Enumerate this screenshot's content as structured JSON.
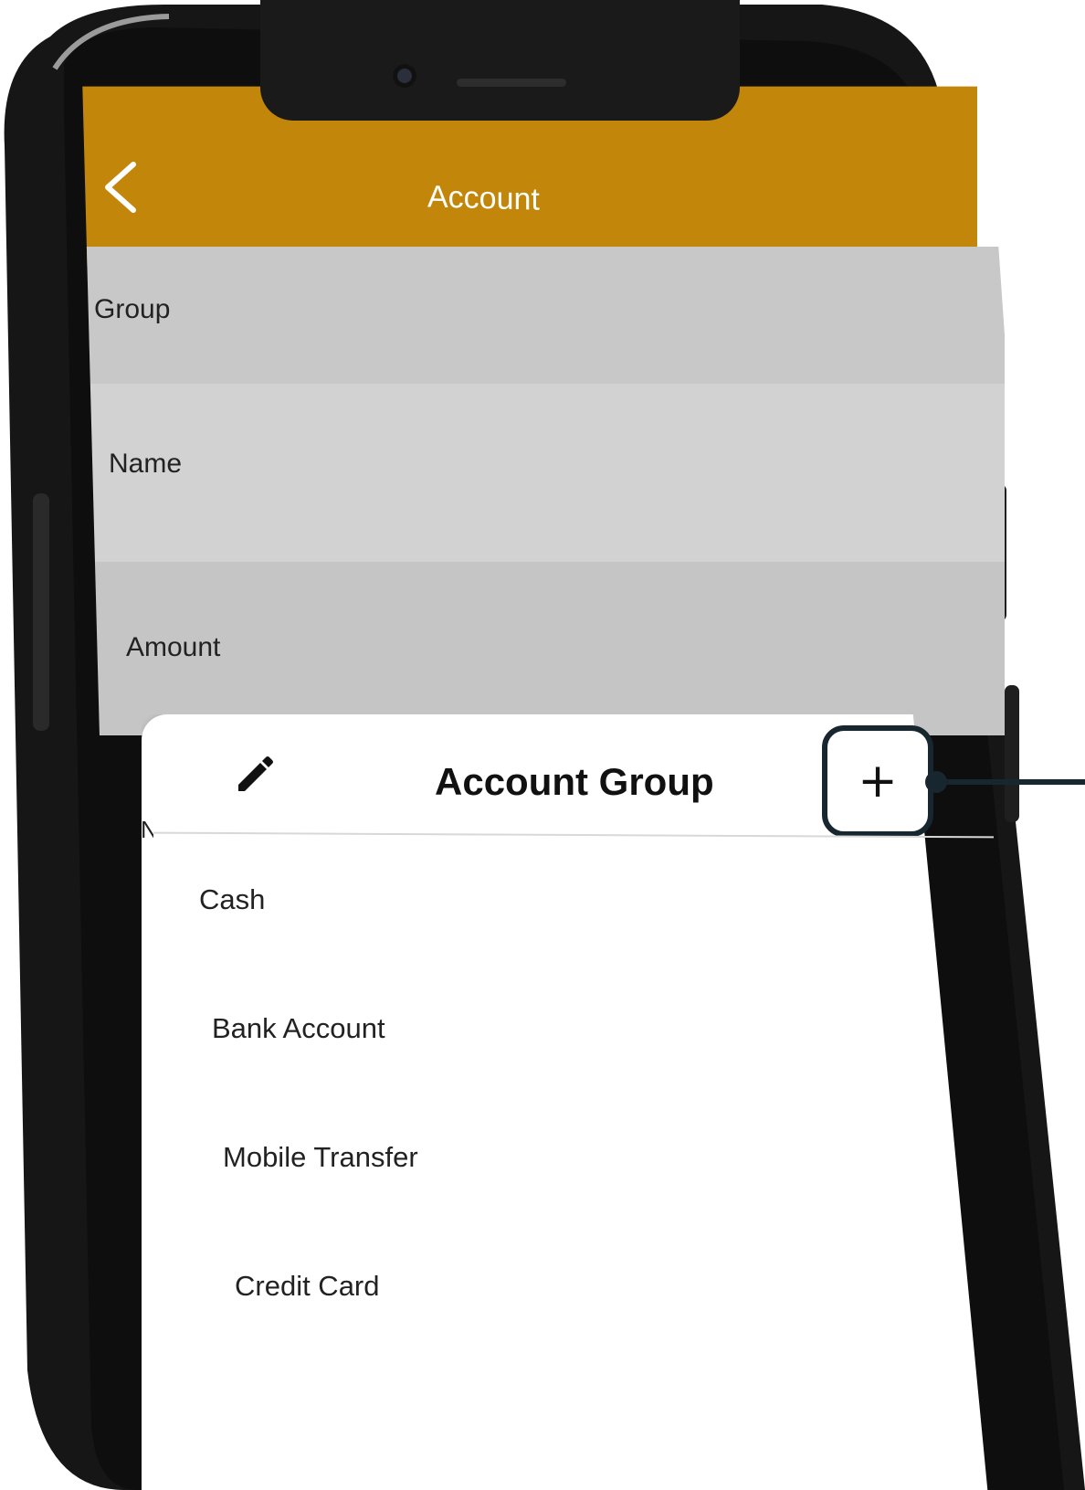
{
  "navbar": {
    "title": "Account",
    "back_icon": "chevron-left-icon",
    "color": "#c2860a"
  },
  "form": {
    "rows": [
      {
        "label": "Group"
      },
      {
        "label": "Name"
      },
      {
        "label": "Amount"
      }
    ]
  },
  "sheet": {
    "title": "Account Group",
    "edit_icon": "pencil-icon",
    "add_icon": "plus-icon",
    "add_label": "+",
    "items": [
      {
        "label": "Cash"
      },
      {
        "label": "Bank Account"
      },
      {
        "label": "Mobile Transfer"
      },
      {
        "label": "Credit Card"
      }
    ]
  },
  "callout": {
    "color": "#17262f"
  }
}
